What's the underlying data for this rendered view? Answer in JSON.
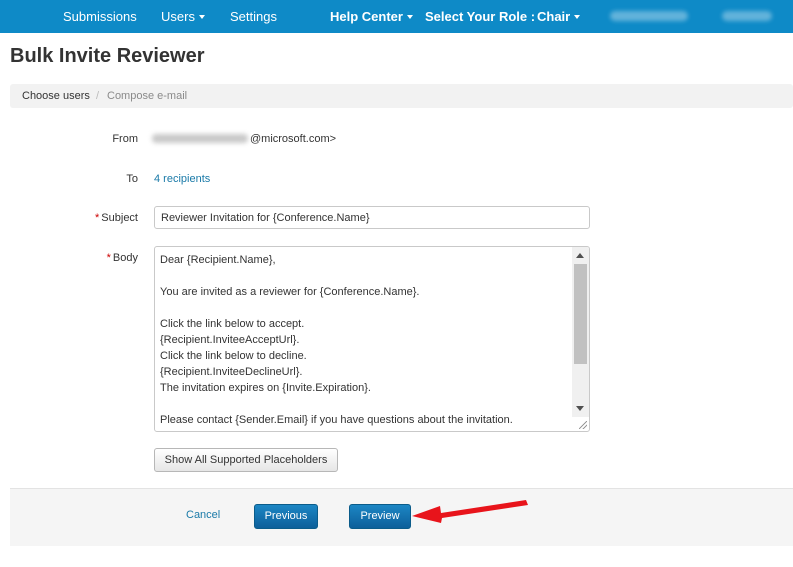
{
  "nav": {
    "submissions": "Submissions",
    "users": "Users",
    "settings": "Settings",
    "help_center": "Help Center",
    "select_role": "Select Your Role :",
    "role": "Chair"
  },
  "page": {
    "title": "Bulk Invite Reviewer"
  },
  "breadcrumb": {
    "items": [
      "Choose users",
      "Compose e-mail"
    ],
    "separator": "/"
  },
  "form": {
    "from_label": "From",
    "from_domain": "@microsoft.com>",
    "to_label": "To",
    "to_value": "4 recipients",
    "required_mark": "*",
    "subject_label": "Subject",
    "subject_value": "Reviewer Invitation for {Conference.Name}",
    "body_label": "Body",
    "body_value": "Dear {Recipient.Name},\n\nYou are invited as a reviewer for {Conference.Name}.\n\nClick the link below to accept.\n{Recipient.InviteeAcceptUrl}.\nClick the link below to decline.\n{Recipient.InviteeDeclineUrl}.\nThe invitation expires on {Invite.Expiration}.\n\nPlease contact {Sender.Email} if you have questions about the invitation.",
    "placeholders_button": "Show All Supported Placeholders"
  },
  "footer": {
    "cancel": "Cancel",
    "previous": "Previous",
    "preview": "Preview"
  },
  "colors": {
    "nav_bg": "#0e8ac7",
    "link": "#1a7aa8",
    "primary_button": "#0d5f9a",
    "annotation_arrow": "#e8141b"
  }
}
